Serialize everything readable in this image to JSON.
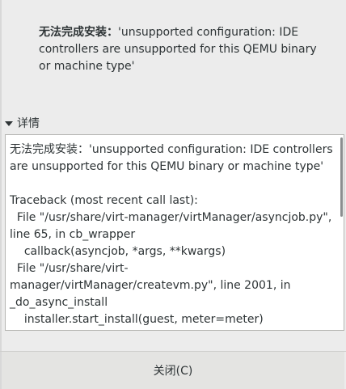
{
  "dialog": {
    "message_prefix": "无法完成安装：",
    "message_body": "'unsupported configuration: IDE controllers are unsupported for this QEMU binary or machine type'",
    "expander_label": "详情",
    "details_text": "无法完成安装：'unsupported configuration: IDE controllers are unsupported for this QEMU binary or machine type'\n\nTraceback (most recent call last):\n  File \"/usr/share/virt-manager/virtManager/asyncjob.py\", line 65, in cb_wrapper\n    callback(asyncjob, *args, **kwargs)\n  File \"/usr/share/virt-manager/virtManager/createvm.py\", line 2001, in _do_async_install\n    installer.start_install(guest, meter=meter)\n  File \"/usr/share/virt-manager/virtinst/install/installer.py\",",
    "close_label": "关闭(C)"
  }
}
